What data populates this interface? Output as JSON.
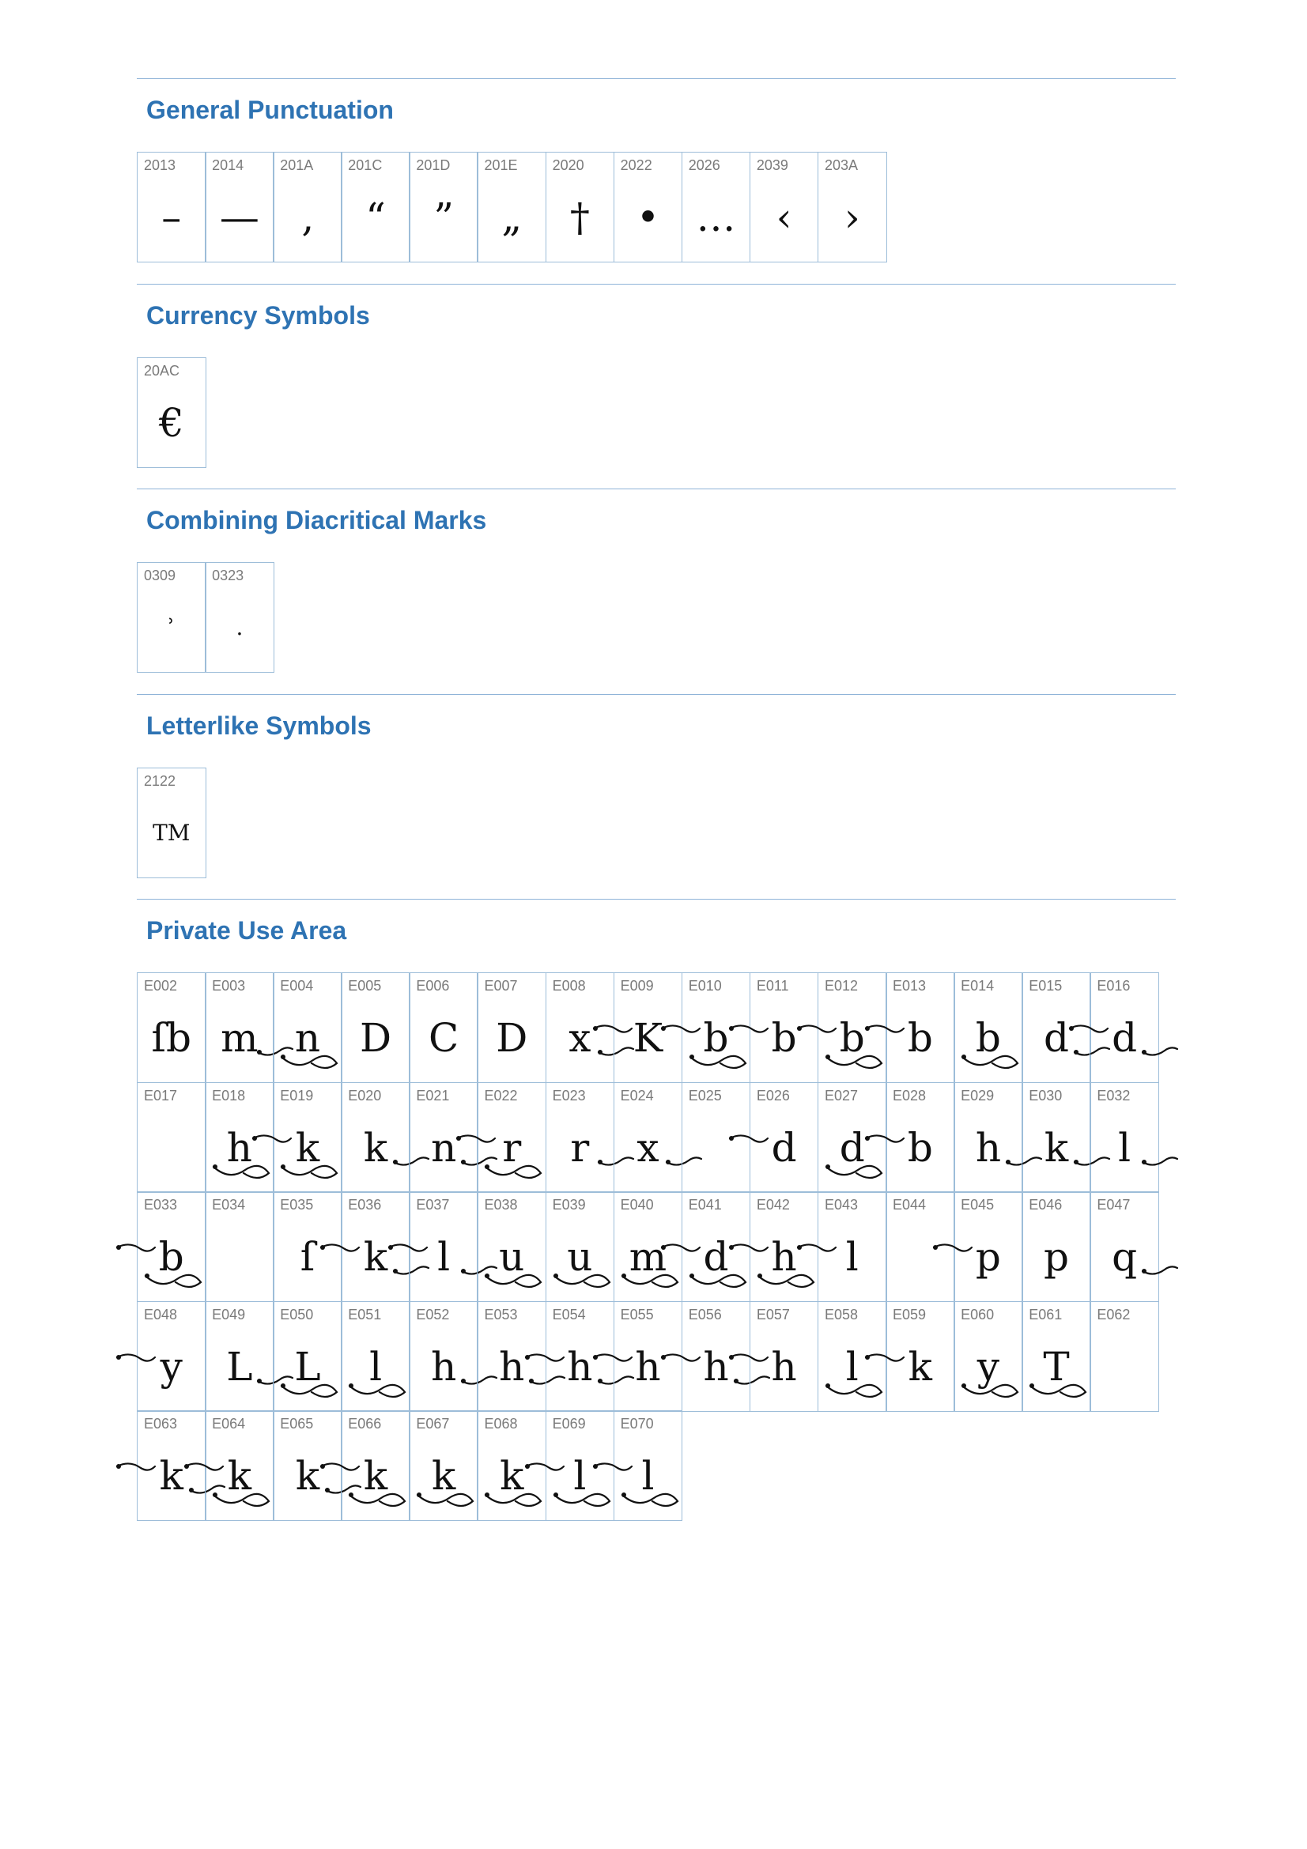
{
  "sections": [
    {
      "title": "General Punctuation",
      "cells": [
        {
          "code": "2013",
          "glyph": "–"
        },
        {
          "code": "2014",
          "glyph": "—"
        },
        {
          "code": "201A",
          "glyph": "‚"
        },
        {
          "code": "201C",
          "glyph": "“"
        },
        {
          "code": "201D",
          "glyph": "”"
        },
        {
          "code": "201E",
          "glyph": "„"
        },
        {
          "code": "2020",
          "glyph": "†"
        },
        {
          "code": "2022",
          "glyph": "•"
        },
        {
          "code": "2026",
          "glyph": "…"
        },
        {
          "code": "2039",
          "glyph": "‹"
        },
        {
          "code": "203A",
          "glyph": "›"
        }
      ]
    },
    {
      "title": "Currency Symbols",
      "cells": [
        {
          "code": "20AC",
          "glyph": "€"
        }
      ]
    },
    {
      "title": "Combining Diacritical Marks",
      "cells": [
        {
          "code": "0309",
          "glyph": "ʾ"
        },
        {
          "code": "0323",
          "glyph": "."
        }
      ]
    },
    {
      "title": "Letterlike Symbols",
      "cells": [
        {
          "code": "2122",
          "glyph": "TM"
        }
      ]
    },
    {
      "title": "Private Use Area",
      "cells": [
        {
          "code": "E002",
          "glyph": "ſb"
        },
        {
          "code": "E003",
          "glyph": "m"
        },
        {
          "code": "E004",
          "glyph": "n"
        },
        {
          "code": "E005",
          "glyph": "D"
        },
        {
          "code": "E006",
          "glyph": "C"
        },
        {
          "code": "E007",
          "glyph": "D"
        },
        {
          "code": "E008",
          "glyph": "x"
        },
        {
          "code": "E009",
          "glyph": "K"
        },
        {
          "code": "E010",
          "glyph": "b"
        },
        {
          "code": "E011",
          "glyph": "b"
        },
        {
          "code": "E012",
          "glyph": "b"
        },
        {
          "code": "E013",
          "glyph": "b"
        },
        {
          "code": "E014",
          "glyph": "b"
        },
        {
          "code": "E015",
          "glyph": "d"
        },
        {
          "code": "E016",
          "glyph": "d"
        },
        {
          "code": "E017",
          "glyph": ""
        },
        {
          "code": "E018",
          "glyph": "h"
        },
        {
          "code": "E019",
          "glyph": "k"
        },
        {
          "code": "E020",
          "glyph": "k"
        },
        {
          "code": "E021",
          "glyph": "n"
        },
        {
          "code": "E022",
          "glyph": "r"
        },
        {
          "code": "E023",
          "glyph": "r"
        },
        {
          "code": "E024",
          "glyph": "x"
        },
        {
          "code": "E025",
          "glyph": ""
        },
        {
          "code": "E026",
          "glyph": "d"
        },
        {
          "code": "E027",
          "glyph": "d"
        },
        {
          "code": "E028",
          "glyph": "b"
        },
        {
          "code": "E029",
          "glyph": "h"
        },
        {
          "code": "E030",
          "glyph": "k"
        },
        {
          "code": "E032",
          "glyph": "l"
        },
        {
          "code": "E033",
          "glyph": "b"
        },
        {
          "code": "E034",
          "glyph": ""
        },
        {
          "code": "E035",
          "glyph": "ſ"
        },
        {
          "code": "E036",
          "glyph": "k"
        },
        {
          "code": "E037",
          "glyph": "l"
        },
        {
          "code": "E038",
          "glyph": "u"
        },
        {
          "code": "E039",
          "glyph": "u"
        },
        {
          "code": "E040",
          "glyph": "m"
        },
        {
          "code": "E041",
          "glyph": "d"
        },
        {
          "code": "E042",
          "glyph": "h"
        },
        {
          "code": "E043",
          "glyph": "l"
        },
        {
          "code": "E044",
          "glyph": ""
        },
        {
          "code": "E045",
          "glyph": "p"
        },
        {
          "code": "E046",
          "glyph": "p"
        },
        {
          "code": "E047",
          "glyph": "q"
        },
        {
          "code": "E048",
          "glyph": "y"
        },
        {
          "code": "E049",
          "glyph": "L"
        },
        {
          "code": "E050",
          "glyph": "L"
        },
        {
          "code": "E051",
          "glyph": "l"
        },
        {
          "code": "E052",
          "glyph": "h"
        },
        {
          "code": "E053",
          "glyph": "h"
        },
        {
          "code": "E054",
          "glyph": "h"
        },
        {
          "code": "E055",
          "glyph": "h"
        },
        {
          "code": "E056",
          "glyph": "h"
        },
        {
          "code": "E057",
          "glyph": "h"
        },
        {
          "code": "E058",
          "glyph": "l"
        },
        {
          "code": "E059",
          "glyph": "k"
        },
        {
          "code": "E060",
          "glyph": "y"
        },
        {
          "code": "E061",
          "glyph": "T"
        },
        {
          "code": "E062",
          "glyph": ""
        },
        {
          "code": "E063",
          "glyph": "k"
        },
        {
          "code": "E064",
          "glyph": "k"
        },
        {
          "code": "E065",
          "glyph": "k"
        },
        {
          "code": "E066",
          "glyph": "k"
        },
        {
          "code": "E067",
          "glyph": "k"
        },
        {
          "code": "E068",
          "glyph": "k"
        },
        {
          "code": "E069",
          "glyph": "l"
        },
        {
          "code": "E070",
          "glyph": "l"
        }
      ]
    }
  ]
}
